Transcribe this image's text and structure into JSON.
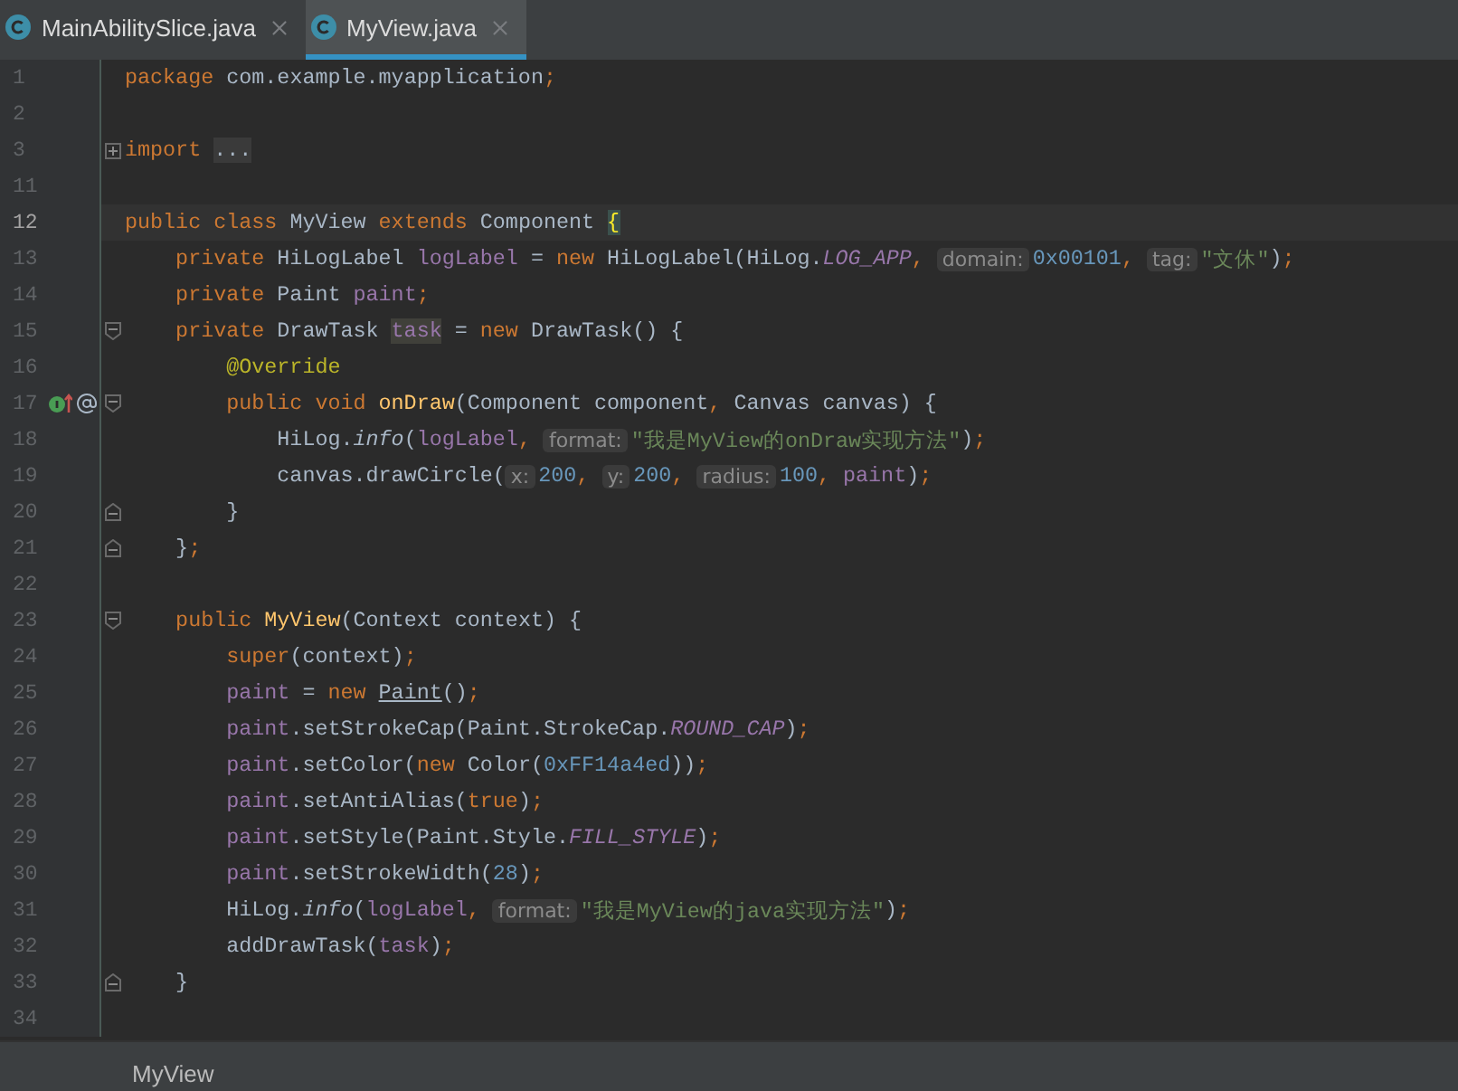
{
  "tabs": [
    {
      "label": "MainAbilitySlice.java",
      "selected": false
    },
    {
      "label": "MyView.java",
      "selected": true
    }
  ],
  "lines": [
    {
      "number": "1",
      "current": false,
      "kind": "plain",
      "tokens": [
        {
          "kind": "kw",
          "text": "package"
        },
        {
          "kind": "plain",
          "text": " com.example.myapplication"
        },
        {
          "kind": "kw",
          "text": ";"
        }
      ]
    },
    {
      "number": "2",
      "current": false,
      "kind": "plain"
    },
    {
      "number": "3",
      "current": false,
      "kind": "folded",
      "tokens": [
        {
          "kind": "kw",
          "text": "import "
        },
        {
          "kind": "folded",
          "text": "..."
        }
      ]
    },
    {
      "number": "11",
      "current": false,
      "kind": "plain"
    },
    {
      "number": "12",
      "current": true,
      "kind": "plain",
      "tokens": [
        {
          "kind": "kw",
          "text": "public class "
        },
        {
          "kind": "plain",
          "text": "MyView "
        },
        {
          "kind": "kw",
          "text": "extends "
        },
        {
          "kind": "plain",
          "text": "Component "
        },
        {
          "kind": "brace",
          "text": "{"
        }
      ]
    },
    {
      "number": "13",
      "current": false,
      "kind": "plain",
      "tokens": [
        {
          "kind": "kw",
          "text": "    private "
        },
        {
          "kind": "plain",
          "text": "HiLogLabel "
        },
        {
          "kind": "field",
          "text": "logLabel"
        },
        {
          "kind": "plain",
          "text": " = "
        },
        {
          "kind": "kw",
          "text": "new "
        },
        {
          "kind": "plain",
          "text": "HiLogLabel(HiLog."
        },
        {
          "kind": "const",
          "text": "LOG_APP"
        },
        {
          "kind": "kw",
          "text": ", "
        },
        {
          "kind": "hint",
          "text": "domain:"
        },
        {
          "kind": "number",
          "text": "0x00101"
        },
        {
          "kind": "kw",
          "text": ", "
        },
        {
          "kind": "hint",
          "text": "tag:"
        },
        {
          "kind": "string",
          "text": "\"文休\""
        },
        {
          "kind": "plain",
          "text": ")"
        },
        {
          "kind": "kw",
          "text": ";"
        }
      ]
    },
    {
      "number": "14",
      "current": false,
      "kind": "plain",
      "tokens": [
        {
          "kind": "kw",
          "text": "    private "
        },
        {
          "kind": "plain",
          "text": "Paint "
        },
        {
          "kind": "field",
          "text": "paint"
        },
        {
          "kind": "kw",
          "text": ";"
        }
      ]
    },
    {
      "number": "15",
      "current": false,
      "kind": "fold-start",
      "tokens": [
        {
          "kind": "kw",
          "text": "    private "
        },
        {
          "kind": "plain",
          "text": "DrawTask "
        },
        {
          "kind": "usage",
          "text": "task"
        },
        {
          "kind": "plain",
          "text": " = "
        },
        {
          "kind": "kw",
          "text": "new "
        },
        {
          "kind": "plain",
          "text": "DrawTask() {"
        }
      ]
    },
    {
      "number": "16",
      "current": false,
      "kind": "plain",
      "tokens": [
        {
          "kind": "annotation",
          "text": "        @Override"
        }
      ]
    },
    {
      "number": "17",
      "current": false,
      "kind": "fold-start",
      "marks": [
        {
          "kind": "implements"
        },
        {
          "kind": "at"
        }
      ],
      "tokens": [
        {
          "kind": "kw",
          "text": "        public void "
        },
        {
          "kind": "method",
          "text": "onDraw"
        },
        {
          "kind": "plain",
          "text": "(Component component"
        },
        {
          "kind": "kw",
          "text": ", "
        },
        {
          "kind": "plain",
          "text": "Canvas canvas) {"
        }
      ]
    },
    {
      "number": "18",
      "current": false,
      "kind": "plain",
      "tokens": [
        {
          "kind": "plain",
          "text": "            HiLog."
        },
        {
          "kind": "static",
          "text": "info"
        },
        {
          "kind": "plain",
          "text": "("
        },
        {
          "kind": "field",
          "text": "logLabel"
        },
        {
          "kind": "kw",
          "text": ", "
        },
        {
          "kind": "hint",
          "text": "format:"
        },
        {
          "kind": "string",
          "text": "\"我是MyView的onDraw实现方法\""
        },
        {
          "kind": "plain",
          "text": ")"
        },
        {
          "kind": "kw",
          "text": ";"
        }
      ]
    },
    {
      "number": "19",
      "current": false,
      "kind": "plain",
      "tokens": [
        {
          "kind": "plain",
          "text": "            canvas.drawCircle("
        },
        {
          "kind": "hint",
          "text": "x:"
        },
        {
          "kind": "number",
          "text": "200"
        },
        {
          "kind": "kw",
          "text": ", "
        },
        {
          "kind": "hint",
          "text": "y:"
        },
        {
          "kind": "number",
          "text": "200"
        },
        {
          "kind": "kw",
          "text": ", "
        },
        {
          "kind": "hint",
          "text": "radius:"
        },
        {
          "kind": "number",
          "text": "100"
        },
        {
          "kind": "kw",
          "text": ", "
        },
        {
          "kind": "field",
          "text": "paint"
        },
        {
          "kind": "plain",
          "text": ")"
        },
        {
          "kind": "kw",
          "text": ";"
        }
      ]
    },
    {
      "number": "20",
      "current": false,
      "kind": "fold-end",
      "tokens": [
        {
          "kind": "plain",
          "text": "        }"
        }
      ]
    },
    {
      "number": "21",
      "current": false,
      "kind": "fold-end",
      "tokens": [
        {
          "kind": "plain",
          "text": "    }"
        },
        {
          "kind": "kw",
          "text": ";"
        }
      ]
    },
    {
      "number": "22",
      "current": false,
      "kind": "plain"
    },
    {
      "number": "23",
      "current": false,
      "kind": "fold-start",
      "tokens": [
        {
          "kind": "kw",
          "text": "    public "
        },
        {
          "kind": "method",
          "text": "MyView"
        },
        {
          "kind": "plain",
          "text": "(Context context) {"
        }
      ]
    },
    {
      "number": "24",
      "current": false,
      "kind": "plain",
      "tokens": [
        {
          "kind": "kw",
          "text": "        super"
        },
        {
          "kind": "plain",
          "text": "(context)"
        },
        {
          "kind": "kw",
          "text": ";"
        }
      ]
    },
    {
      "number": "25",
      "current": false,
      "kind": "plain",
      "tokens": [
        {
          "kind": "field",
          "text": "        paint"
        },
        {
          "kind": "plain",
          "text": " = "
        },
        {
          "kind": "kw",
          "text": "new "
        },
        {
          "kind": "underline",
          "text": "Paint"
        },
        {
          "kind": "plain",
          "text": "()"
        },
        {
          "kind": "kw",
          "text": ";"
        }
      ]
    },
    {
      "number": "26",
      "current": false,
      "kind": "plain",
      "tokens": [
        {
          "kind": "field",
          "text": "        paint"
        },
        {
          "kind": "plain",
          "text": ".setStrokeCap(Paint.StrokeCap."
        },
        {
          "kind": "const",
          "text": "ROUND_CAP"
        },
        {
          "kind": "plain",
          "text": ")"
        },
        {
          "kind": "kw",
          "text": ";"
        }
      ]
    },
    {
      "number": "27",
      "current": false,
      "kind": "plain",
      "tokens": [
        {
          "kind": "field",
          "text": "        paint"
        },
        {
          "kind": "plain",
          "text": ".setColor("
        },
        {
          "kind": "kw",
          "text": "new "
        },
        {
          "kind": "plain",
          "text": "Color("
        },
        {
          "kind": "number",
          "text": "0xFF14a4ed"
        },
        {
          "kind": "plain",
          "text": "))"
        },
        {
          "kind": "kw",
          "text": ";"
        }
      ]
    },
    {
      "number": "28",
      "current": false,
      "kind": "plain",
      "tokens": [
        {
          "kind": "field",
          "text": "        paint"
        },
        {
          "kind": "plain",
          "text": ".setAntiAlias("
        },
        {
          "kind": "kw",
          "text": "true"
        },
        {
          "kind": "plain",
          "text": ")"
        },
        {
          "kind": "kw",
          "text": ";"
        }
      ]
    },
    {
      "number": "29",
      "current": false,
      "kind": "plain",
      "tokens": [
        {
          "kind": "field",
          "text": "        paint"
        },
        {
          "kind": "plain",
          "text": ".setStyle(Paint.Style."
        },
        {
          "kind": "const",
          "text": "FILL_STYLE"
        },
        {
          "kind": "plain",
          "text": ")"
        },
        {
          "kind": "kw",
          "text": ";"
        }
      ]
    },
    {
      "number": "30",
      "current": false,
      "kind": "plain",
      "tokens": [
        {
          "kind": "field",
          "text": "        paint"
        },
        {
          "kind": "plain",
          "text": ".setStrokeWidth("
        },
        {
          "kind": "number",
          "text": "28"
        },
        {
          "kind": "plain",
          "text": ")"
        },
        {
          "kind": "kw",
          "text": ";"
        }
      ]
    },
    {
      "number": "31",
      "current": false,
      "kind": "plain",
      "tokens": [
        {
          "kind": "plain",
          "text": "        HiLog."
        },
        {
          "kind": "static",
          "text": "info"
        },
        {
          "kind": "plain",
          "text": "("
        },
        {
          "kind": "field",
          "text": "logLabel"
        },
        {
          "kind": "kw",
          "text": ", "
        },
        {
          "kind": "hint",
          "text": "format:"
        },
        {
          "kind": "string",
          "text": "\"我是MyView的java实现方法\""
        },
        {
          "kind": "plain",
          "text": ")"
        },
        {
          "kind": "kw",
          "text": ";"
        }
      ]
    },
    {
      "number": "32",
      "current": false,
      "kind": "plain",
      "tokens": [
        {
          "kind": "plain",
          "text": "        addDrawTask("
        },
        {
          "kind": "field",
          "text": "task"
        },
        {
          "kind": "plain",
          "text": ")"
        },
        {
          "kind": "kw",
          "text": ";"
        }
      ]
    },
    {
      "number": "33",
      "current": false,
      "kind": "fold-end",
      "tokens": [
        {
          "kind": "plain",
          "text": "    }"
        }
      ]
    },
    {
      "number": "34",
      "current": false,
      "kind": "plain"
    }
  ],
  "breadcrumb": "MyView"
}
